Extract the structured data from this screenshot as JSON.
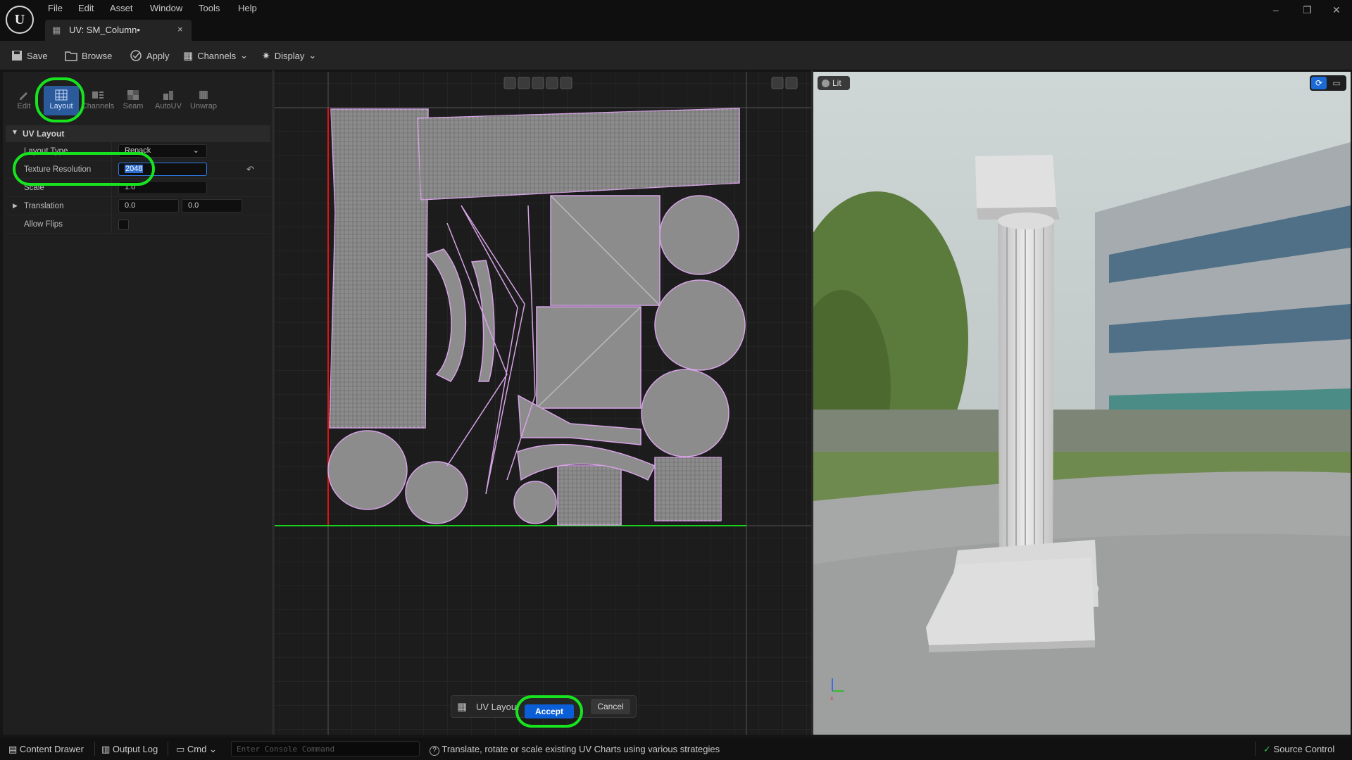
{
  "menu": [
    "File",
    "Edit",
    "Asset",
    "Window",
    "Tools",
    "Help"
  ],
  "doc_tab": {
    "title": "UV: SM_Column•",
    "close": "×"
  },
  "window_controls": {
    "minimize": "–",
    "restore": "❐",
    "close": "✕"
  },
  "toolbar": {
    "save": "Save",
    "browse": "Browse",
    "apply": "Apply",
    "channels": "Channels",
    "display": "Display"
  },
  "tools": [
    {
      "label": "Edit",
      "icon": "pencil-icon"
    },
    {
      "label": "Layout",
      "icon": "layout-grid-icon",
      "active": true
    },
    {
      "label": "Channels",
      "icon": "channels-icon"
    },
    {
      "label": "Seam",
      "icon": "seam-icon"
    },
    {
      "label": "AutoUV",
      "icon": "autouv-icon"
    },
    {
      "label": "Unwrap",
      "icon": "unwrap-icon"
    }
  ],
  "properties": {
    "section": "UV Layout",
    "layout_type": {
      "label": "Layout Type",
      "value": "Repack"
    },
    "texture_resolution": {
      "label": "Texture Resolution",
      "value": "2048"
    },
    "scale": {
      "label": "Scale",
      "value": "1.0"
    },
    "translation": {
      "label": "Translation",
      "x": "0.0",
      "y": "0.0"
    },
    "allow_flips": {
      "label": "Allow Flips",
      "checked": false
    }
  },
  "viewport": {
    "view_mode": "Lit"
  },
  "tool_popup": {
    "label": "UV Layout",
    "accept": "Accept",
    "cancel": "Cancel"
  },
  "statusbar": {
    "content_drawer": "Content Drawer",
    "output_log": "Output Log",
    "cmd": "Cmd",
    "console_placeholder": "Enter Console Command",
    "hint": "Translate, rotate or scale existing UV Charts using various strategies",
    "source_control": "Source Control"
  },
  "colors": {
    "accent": "#0a5ed8",
    "highlight": "#17e41f",
    "uv_wire": "#d7a3e6",
    "uv_fill": "#8c8c8c"
  }
}
